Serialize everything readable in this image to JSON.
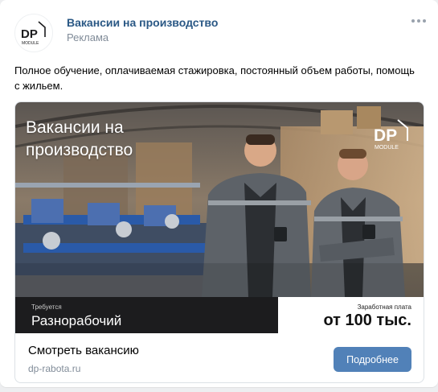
{
  "post": {
    "author": "Вакансии на производство",
    "ad_label": "Реклама",
    "text": "Полное обучение, оплачиваемая стажировка, постоянный объем работы, помощь с жильем.",
    "more_icon": "more-horizontal-icon"
  },
  "avatar": {
    "logo_text": "DP",
    "logo_subtext": "MODULE"
  },
  "ad": {
    "banner_title": "Вакансии на производство",
    "logo_text": "DP",
    "logo_subtext": "MODULE",
    "required_label": "Требуется",
    "required_value": "Разнорабочий",
    "salary_label": "Заработная плата",
    "salary_value": "от 100 тыс.",
    "link_title": "Смотреть вакансию",
    "domain": "dp-rabota.ru",
    "button_label": "Подробнее"
  },
  "colors": {
    "link": "#2a5885",
    "button": "#5181b8",
    "muted": "#818c99",
    "dark_strip": "#1c1c1e"
  }
}
